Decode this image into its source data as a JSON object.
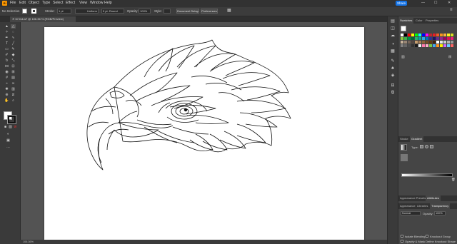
{
  "menubar": {
    "app_logo": "Ai",
    "items": [
      "File",
      "Edit",
      "Object",
      "Type",
      "Select",
      "Effect",
      "View",
      "Window",
      "Help"
    ],
    "share_label": "Share",
    "window_controls": [
      "—",
      "☐",
      "✕"
    ]
  },
  "controlbar": {
    "selection_label": "No Selection",
    "stroke_label": "Stroke:",
    "stroke_value": "1 pt",
    "uniform_label": "Uniform",
    "brush_label": "5 pt. Round",
    "opacity_label": "Opacity:",
    "opacity_value": "100%",
    "style_label": "Style:",
    "document_setup": "Document Setup",
    "preferences": "Preferences"
  },
  "document": {
    "tab_title": "67-full.ai* @ 106.36 % (RGB/Preview)",
    "close_icon": "✕"
  },
  "panels": {
    "swatches_tabs": [
      "Swatches",
      "Color",
      "Properties"
    ],
    "gradient_tabs": [
      "Stroke",
      "Gradient"
    ],
    "gradient_type_label": "Type:",
    "lower_tabs": [
      "Appearance Presets",
      "Attributes"
    ],
    "transparency_tabs": [
      "Appearance",
      "Libraries",
      "Transparency"
    ],
    "blend_mode": "Normal",
    "opacity_label": "Opacity:",
    "opacity_value": "100%",
    "isolate_blending": "Isolate Blending",
    "knockout_group": "Knockout Group",
    "opacity_mask": "Opacity & Mask Define Knockout Shape"
  },
  "swatch_colors": [
    "#ffffff",
    "#000000",
    "#ff0000",
    "#ffff00",
    "#00ff00",
    "#00ffff",
    "#0000ff",
    "#ff00ff",
    "#c1272d",
    "#ed1c24",
    "#f15a24",
    "#f7931e",
    "#fbb03b",
    "#fcee21",
    "#d9e021",
    "#8cc63f",
    "#39b54a",
    "#009245",
    "#006837",
    "#22b573",
    "#00a99d",
    "#29abe2",
    "#0071bc",
    "#2e3192",
    "#1b1464",
    "#662d91",
    "#93278f",
    "#9e005d",
    "#d4145a",
    "#ed1e79",
    "#c7b299",
    "#998675",
    "#736357",
    "#534741",
    "#c69c6d",
    "#a67c52",
    "#8c6239",
    "#754c24",
    "#603813",
    "#42210b",
    "#ffffff",
    "#e6e6e6",
    "#cccccc",
    "#b3b3b3",
    "#999999",
    "#808080",
    "#666666",
    "#4d4d4d",
    "#333333",
    "#1a1a1a",
    "#f2f2f2",
    "#ff7bac",
    "#ffb0c8",
    "#7ac943",
    "#3fa9f5",
    "#ff931e",
    "#fff200",
    "#cc66ff",
    "#66ccff",
    "#ff6666"
  ],
  "status": {
    "zoom": "106.36%"
  }
}
